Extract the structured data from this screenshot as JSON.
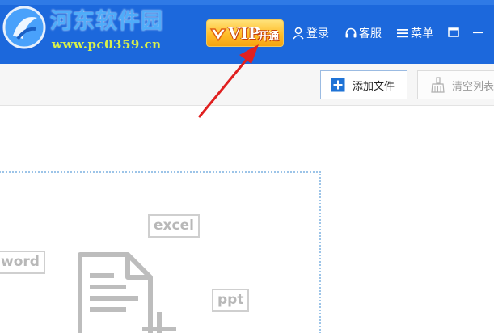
{
  "watermark": {
    "name": "河东软件园",
    "url": "www.pc0359.cn"
  },
  "header": {
    "vip_label": "VIP",
    "vip_open_label": "开通",
    "login_label": "登录",
    "service_label": "客服",
    "menu_label": "菜单"
  },
  "toolbar": {
    "add_file_label": "添加文件",
    "clear_list_label": "清空列表"
  },
  "drop_area": {
    "tags": [
      "excel",
      "word",
      "ppt"
    ]
  },
  "colors": {
    "titlebar": "#1c68dc",
    "vip_gold": "#ffbe2a",
    "annotation_arrow": "#e02020",
    "add_icon": "#1f73d6"
  },
  "icons": {
    "login": "user-icon",
    "service": "headset-icon",
    "menu": "hamburger-icon",
    "window": "window-restore-icon",
    "minimize": "minimize-icon",
    "add": "plus-square-icon",
    "clear": "broom-icon",
    "document": "document-add-icon"
  }
}
